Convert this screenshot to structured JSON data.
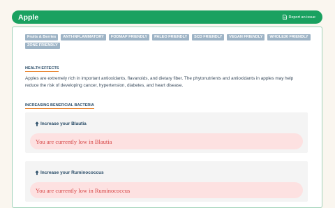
{
  "header": {
    "title": "Apple",
    "report_label": "Report an issue",
    "report_icon": "document-icon",
    "accent_color": "#1aa160"
  },
  "tags": [
    "Fruits & Berries",
    "ANTI-INFLAMMATORY",
    "FODMAP FRIENDLY",
    "PALEO FRIENDLY",
    "SCD FRIENDLY",
    "VEGAN FRIENDLY",
    "WHOLE30 FRIENDLY",
    "ZONE FRIENDLY"
  ],
  "health": {
    "title": "HEALTH EFFECTS",
    "text": "Apples are extremely rich in important antioxidants, flavanoids, and dietary fiber. The phytonutrients and antioxidants in apples may help reduce the risk of developing cancer, hypertension, diabetes, and heart disease."
  },
  "bacteria": {
    "title": "INCREASING BENEFICIAL BACTERIA",
    "items": [
      {
        "title": "Increase your Blautia",
        "status": "You are currently low in Blautia"
      },
      {
        "title": "Increase your Ruminococcus",
        "status": "You are currently low in Ruminococcus"
      }
    ]
  }
}
